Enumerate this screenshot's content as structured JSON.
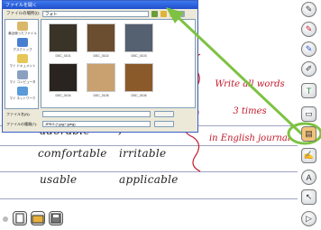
{
  "dialog": {
    "title": "ファイルを開く",
    "look_in_label": "ファイルの場所(I):",
    "look_in_value": "フォト",
    "places": [
      {
        "label": "最近使ったファイル",
        "icon": "recent-icon"
      },
      {
        "label": "デスクトップ",
        "icon": "desktop-icon"
      },
      {
        "label": "マイ ドキュメント",
        "icon": "documents-icon"
      },
      {
        "label": "マイ コンピュータ",
        "icon": "computer-icon"
      },
      {
        "label": "マイ ネットワーク",
        "icon": "network-icon"
      }
    ],
    "thumbnails": [
      {
        "caption": "DSC_0101",
        "color": "#3a3328"
      },
      {
        "caption": "DSC_0102",
        "color": "#6b4d2f"
      },
      {
        "caption": "DSC_0103",
        "color": "#556070"
      },
      {
        "caption": "DSC_0104",
        "color": "#2a2420"
      },
      {
        "caption": "DSC_0105",
        "color": "#c9a070"
      },
      {
        "caption": "DSC_0106",
        "color": "#8b5a2b"
      }
    ],
    "file_name_label": "ファイル名(N):",
    "file_type_label": "ファイルの種類(T):",
    "file_type_value": "JPEG (*.jpg;*.jpeg)"
  },
  "words": {
    "col1": [
      "adorable",
      "comfortable",
      "usable"
    ],
    "col2": [
      "feasible",
      "irritable",
      "applicable"
    ]
  },
  "note": {
    "line1": "Write all words",
    "line2": "3 times",
    "line3": "in English journal"
  },
  "colors": {
    "accent_green": "#7dc242",
    "note_red": "#c2182a",
    "rule": "#9fa3c0"
  },
  "tools": [
    "pen-icon",
    "red-pen-icon",
    "blue-pen-icon",
    "pencil-icon",
    "text-icon",
    "highlighter-icon",
    "image-tool-icon",
    "marker-icon",
    "letter-a-icon",
    "pointer-icon",
    "next-page-icon"
  ],
  "bottom_buttons": [
    "new-page-icon",
    "open-folder-icon",
    "save-icon"
  ]
}
